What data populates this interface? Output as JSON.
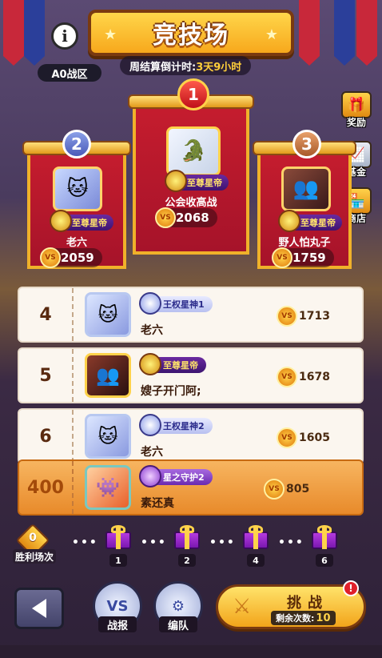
{
  "header": {
    "title": "竞技场",
    "countdown_label": "周结算倒计时:",
    "countdown_value": "3天9小时",
    "zone": "A0战区",
    "info_icon": "i"
  },
  "side_buttons": [
    {
      "label": "奖励",
      "icon": "gift-icon"
    },
    {
      "label": "基金",
      "icon": "fund-icon"
    },
    {
      "label": "商店",
      "icon": "shop-icon"
    }
  ],
  "podium": {
    "first": {
      "rank": "1",
      "badge": "至尊星帝",
      "name": "公会收高战",
      "score": "2068"
    },
    "second": {
      "rank": "2",
      "badge": "至尊星帝",
      "name": "老六",
      "score": "2059"
    },
    "third": {
      "rank": "3",
      "badge": "至尊星帝",
      "name": "野人怕丸子",
      "score": "1759"
    }
  },
  "list": [
    {
      "rank": "4",
      "badge": "王权星神1",
      "name": "老六",
      "score": "1713"
    },
    {
      "rank": "5",
      "badge": "至尊星帝",
      "name": "嫂子开门阿;",
      "score": "1678"
    },
    {
      "rank": "6",
      "badge": "王权星神2",
      "name": "老六",
      "score": "1605"
    }
  ],
  "self": {
    "rank": "400",
    "badge": "星之守护2",
    "name": "素还真",
    "score": "805"
  },
  "progress": {
    "wins": "0",
    "wins_label": "胜利场次",
    "milestones": [
      "1",
      "2",
      "4",
      "6"
    ]
  },
  "bottom": {
    "report_label": "战报",
    "team_label": "编队",
    "report_icon_text": "VS",
    "challenge_label": "挑战",
    "remaining_label": "剩余次数:",
    "remaining_value": "10",
    "alert": "!"
  },
  "coin_text": "VS",
  "colors": {
    "accent_gold": "#f7a81c",
    "banner_red": "#c61d2e",
    "self_row": "#e88a2a"
  }
}
